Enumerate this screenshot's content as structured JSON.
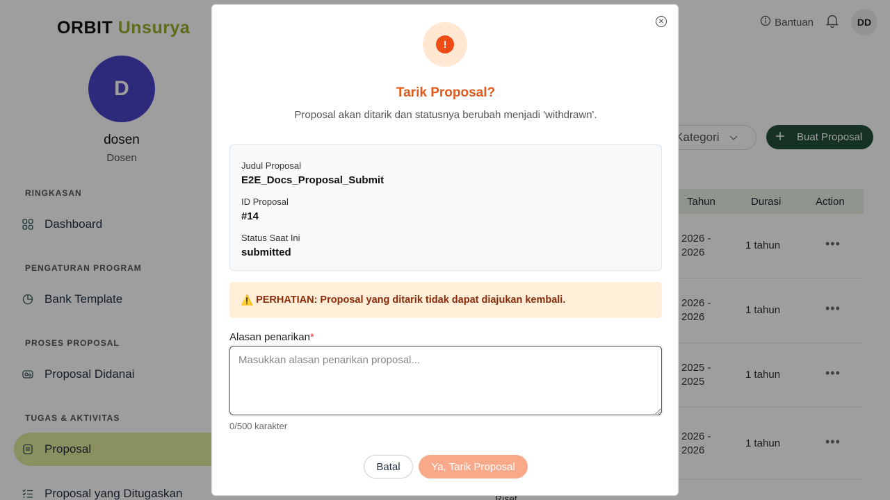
{
  "app": {
    "logo_primary": "ORBIT",
    "logo_secondary": "Unsurya"
  },
  "user": {
    "avatar_initial": "D",
    "name": "dosen",
    "role": "Dosen",
    "avatar_small": "DD"
  },
  "topbar": {
    "help_label": "Bantuan"
  },
  "sidebar": {
    "sections": [
      {
        "title": "RINGKASAN"
      },
      {
        "title": "PENGATURAN PROGRAM"
      },
      {
        "title": "PROSES PROPOSAL"
      },
      {
        "title": "TUGAS & AKTIVITAS"
      }
    ],
    "items": [
      {
        "label": "Dashboard",
        "icon": "grid-icon"
      },
      {
        "label": "Bank Template",
        "icon": "pie-icon"
      },
      {
        "label": "Proposal Didanai",
        "icon": "funded-icon"
      },
      {
        "label": "Proposal",
        "icon": "document-icon",
        "active": true
      },
      {
        "label": "Proposal yang Ditugaskan",
        "icon": "list-check-icon"
      }
    ]
  },
  "toolbar": {
    "category_filter": "a Kategori",
    "create_label": "Buat Proposal"
  },
  "table": {
    "headers": [
      "Tahun",
      "Durasi",
      "Action"
    ],
    "rows": [
      {
        "tahun": "2026 -\n2026",
        "durasi": "1 tahun"
      },
      {
        "tahun": "2026 -\n2026",
        "durasi": "1 tahun"
      },
      {
        "tahun": "2025 -\n2025",
        "durasi": "1 tahun"
      },
      {
        "tahun": "2026 -\n2026",
        "durasi": "1 tahun"
      }
    ],
    "partial_cell": "Riset"
  },
  "modal": {
    "title": "Tarik Proposal?",
    "description": "Proposal akan ditarik dan statusnya berubah menjadi 'withdrawn'.",
    "info": {
      "title_label": "Judul Proposal",
      "title_value": "E2E_Docs_Proposal_Submit",
      "id_label": "ID Proposal",
      "id_value": "#14",
      "status_label": "Status Saat Ini",
      "status_value": "submitted"
    },
    "warning_icon": "⚠️",
    "warning_text": "PERHATIAN: Proposal yang ditarik tidak dapat diajukan kembali.",
    "reason_label": "Alasan penarikan",
    "required_mark": "*",
    "reason_placeholder": "Masukkan alasan penarikan proposal...",
    "reason_value": "",
    "counter": "0/500 karakter",
    "cancel_label": "Batal",
    "confirm_label": "Ya, Tarik Proposal"
  },
  "colors": {
    "brand_green": "#24523b",
    "accent_olive": "#9aae2c",
    "danger_orange": "#e05a1b"
  }
}
